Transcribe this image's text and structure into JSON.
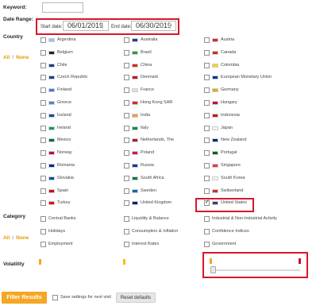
{
  "labels": {
    "keyword": "Keyword:",
    "date_range": "Date Range:",
    "start_date": "Start date:",
    "end_date": "End date:",
    "country": "Country",
    "category": "Category",
    "volatility": "Volatility",
    "all": "All",
    "none": "None",
    "slash": "/"
  },
  "keyword_value": "",
  "dates": {
    "start": "06/01/2019",
    "end": "06/30/2019"
  },
  "countries": [
    {
      "name": "Argentina",
      "checked": false,
      "flag": "#8ec5ea"
    },
    {
      "name": "Australia",
      "checked": false,
      "flag": "#1f3c88"
    },
    {
      "name": "Austria",
      "checked": false,
      "flag": "#cc2a36"
    },
    {
      "name": "Belgium",
      "checked": false,
      "flag": "#222222"
    },
    {
      "name": "Brazil",
      "checked": false,
      "flag": "#2e9b3a"
    },
    {
      "name": "Canada",
      "checked": false,
      "flag": "#d52b1e"
    },
    {
      "name": "Chile",
      "checked": false,
      "flag": "#1f3c88"
    },
    {
      "name": "China",
      "checked": false,
      "flag": "#de2910"
    },
    {
      "name": "Colombia",
      "checked": false,
      "flag": "#fcd116"
    },
    {
      "name": "Czech Republic",
      "checked": false,
      "flag": "#11457e"
    },
    {
      "name": "Denmark",
      "checked": false,
      "flag": "#c8102e"
    },
    {
      "name": "European Monetary Union",
      "checked": false,
      "flag": "#003399"
    },
    {
      "name": "Finland",
      "checked": false,
      "flag": "#4a78c8"
    },
    {
      "name": "France",
      "checked": false,
      "flag": "#e0e0e0"
    },
    {
      "name": "Germany",
      "checked": false,
      "flag": "#e0b000"
    },
    {
      "name": "Greece",
      "checked": false,
      "flag": "#5a7fd0"
    },
    {
      "name": "Hong Kong SAR",
      "checked": false,
      "flag": "#de2910"
    },
    {
      "name": "Hungary",
      "checked": false,
      "flag": "#c8102e"
    },
    {
      "name": "Iceland",
      "checked": false,
      "flag": "#02529c"
    },
    {
      "name": "India",
      "checked": false,
      "flag": "#ff9933"
    },
    {
      "name": "Indonesia",
      "checked": false,
      "flag": "#ce1126"
    },
    {
      "name": "Ireland",
      "checked": false,
      "flag": "#169b62"
    },
    {
      "name": "Italy",
      "checked": false,
      "flag": "#009246"
    },
    {
      "name": "Japan",
      "checked": false,
      "flag": "#f2f2f2"
    },
    {
      "name": "Mexico",
      "checked": false,
      "flag": "#006847"
    },
    {
      "name": "Netherlands, The",
      "checked": false,
      "flag": "#ae1c28"
    },
    {
      "name": "New Zealand",
      "checked": false,
      "flag": "#00247d"
    },
    {
      "name": "Norway",
      "checked": false,
      "flag": "#ba0c2f"
    },
    {
      "name": "Poland",
      "checked": false,
      "flag": "#dc143c"
    },
    {
      "name": "Portugal",
      "checked": false,
      "flag": "#006600"
    },
    {
      "name": "Romania",
      "checked": false,
      "flag": "#002b7f"
    },
    {
      "name": "Russia",
      "checked": false,
      "flag": "#0039a6"
    },
    {
      "name": "Singapore",
      "checked": false,
      "flag": "#ef3340"
    },
    {
      "name": "Slovakia",
      "checked": false,
      "flag": "#0b4ea2"
    },
    {
      "name": "South Africa",
      "checked": false,
      "flag": "#007a4d"
    },
    {
      "name": "South Korea",
      "checked": false,
      "flag": "#f2f2f2"
    },
    {
      "name": "Spain",
      "checked": false,
      "flag": "#c60b1e"
    },
    {
      "name": "Sweden",
      "checked": false,
      "flag": "#006aa7"
    },
    {
      "name": "Switzerland",
      "checked": false,
      "flag": "#d52b1e"
    },
    {
      "name": "Turkey",
      "checked": false,
      "flag": "#e30a17"
    },
    {
      "name": "United Kingdom",
      "checked": false,
      "flag": "#012169"
    },
    {
      "name": "United States",
      "checked": true,
      "flag": "#3c3b6e"
    }
  ],
  "categories": [
    {
      "name": "Central Banks",
      "checked": false
    },
    {
      "name": "Liquidity & Balance",
      "checked": false
    },
    {
      "name": "Industrial & Non-Industrial Activity",
      "checked": false
    },
    {
      "name": "Holidays",
      "checked": false
    },
    {
      "name": "Consumption & Inflation",
      "checked": false
    },
    {
      "name": "Confidence Indices",
      "checked": false
    },
    {
      "name": "Employment",
      "checked": false
    },
    {
      "name": "Interest Rates",
      "checked": false
    },
    {
      "name": "Government",
      "checked": false
    }
  ],
  "volatility": {
    "bar_color_low": "#f5a623",
    "bar_color_mid": "#f2c200",
    "bar_color_high": "#c8102e",
    "slider_low": 0
  },
  "buttons": {
    "filter": "Filter Results",
    "save_settings": "Save settings for next visit",
    "reset": "Reset defaults"
  },
  "colors": {
    "accent": "#f5a623",
    "highlight": "#d6172d"
  }
}
